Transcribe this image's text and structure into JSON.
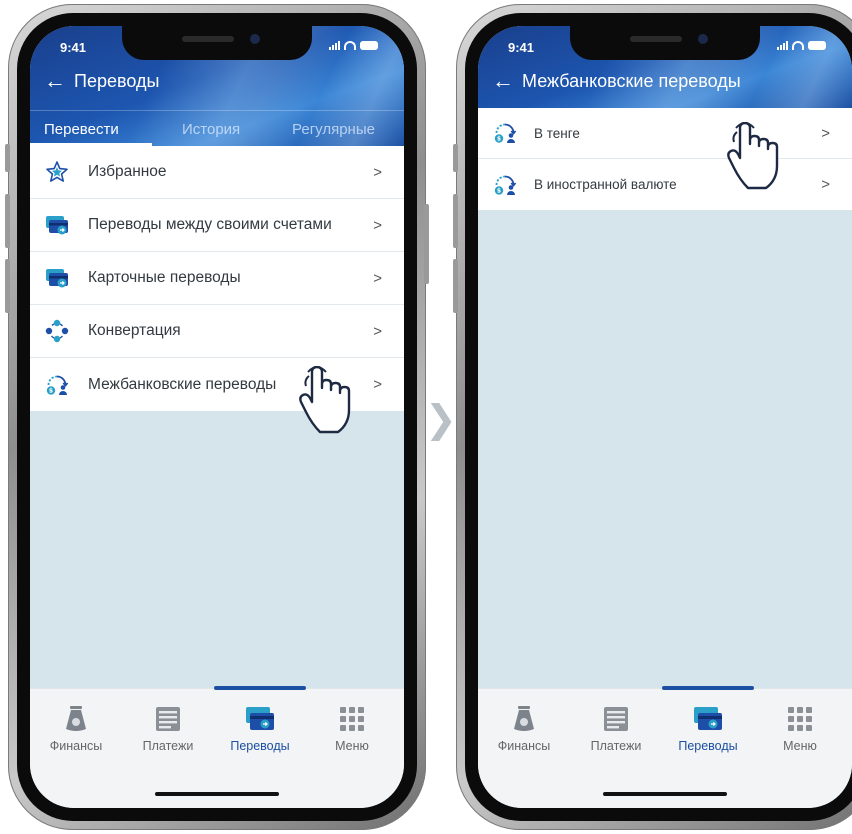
{
  "colors": {
    "accent": "#1b4fa3",
    "icon_blue": "#1e4fa8",
    "icon_teal": "#2aa0c8",
    "screen_background": "#d5e5eb"
  },
  "step_arrow": "❯",
  "left_screen": {
    "status": {
      "time": "9:41"
    },
    "header": {
      "back_icon": "←",
      "title": "Переводы"
    },
    "tabs": [
      {
        "label": "Перевести",
        "active": true
      },
      {
        "label": "История",
        "active": false
      },
      {
        "label": "Регулярные",
        "active": false
      }
    ],
    "items": [
      {
        "label": "Избранное",
        "icon": "star-icon"
      },
      {
        "label": "Переводы между своими счетами",
        "icon": "cards-transfer-icon"
      },
      {
        "label": "Карточные переводы",
        "icon": "card-transfer-icon"
      },
      {
        "label": "Конвертация",
        "icon": "currency-exchange-icon"
      },
      {
        "label": "Межбанковские переводы",
        "icon": "interbank-transfer-icon",
        "tapped": true
      }
    ],
    "chevron": ">",
    "tabbar": [
      {
        "label": "Финансы",
        "icon": "money-bag-icon",
        "active": false
      },
      {
        "label": "Платежи",
        "icon": "payments-list-icon",
        "active": false
      },
      {
        "label": "Переводы",
        "icon": "transfer-card-icon",
        "active": true
      },
      {
        "label": "Меню",
        "icon": "menu-grid-icon",
        "active": false
      }
    ]
  },
  "right_screen": {
    "status": {
      "time": "9:41"
    },
    "header": {
      "back_icon": "←",
      "title": "Межбанковские переводы"
    },
    "items": [
      {
        "label": "В тенге",
        "icon": "interbank-transfer-icon",
        "tapped": true
      },
      {
        "label": "В иностранной валюте",
        "icon": "interbank-transfer-icon"
      }
    ],
    "chevron": ">",
    "tabbar": [
      {
        "label": "Финансы",
        "icon": "money-bag-icon",
        "active": false
      },
      {
        "label": "Платежи",
        "icon": "payments-list-icon",
        "active": false
      },
      {
        "label": "Переводы",
        "icon": "transfer-card-icon",
        "active": true
      },
      {
        "label": "Меню",
        "icon": "menu-grid-icon",
        "active": false
      }
    ]
  }
}
